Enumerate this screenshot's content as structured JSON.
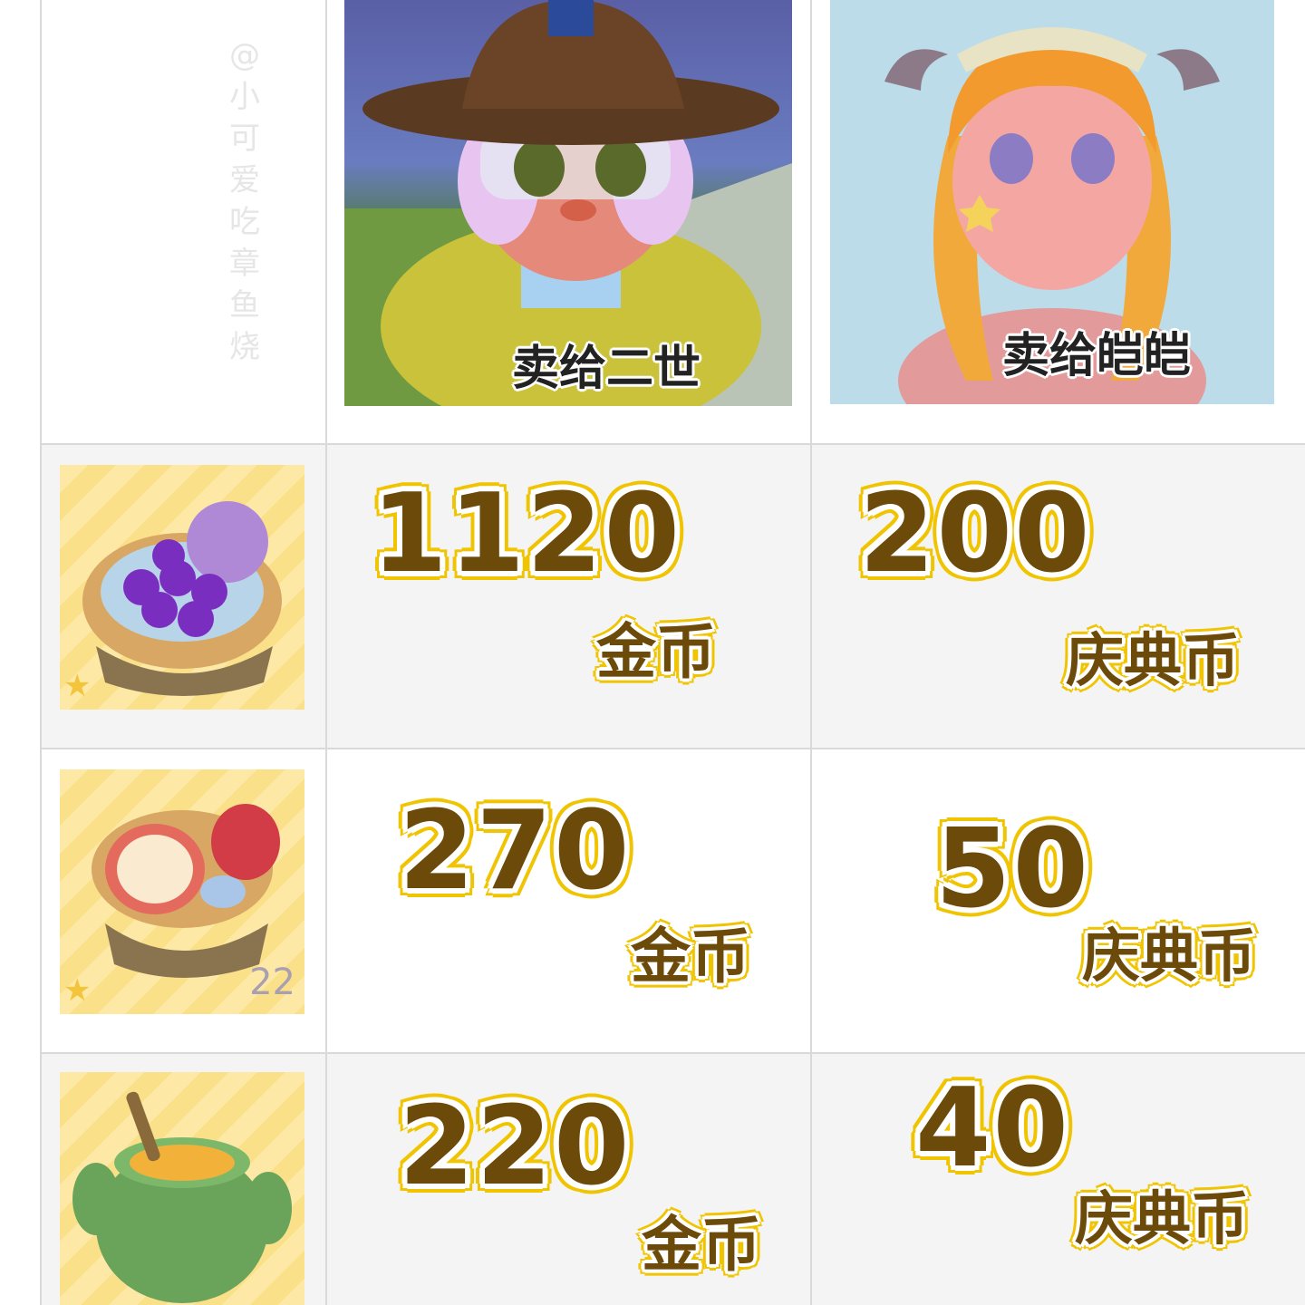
{
  "watermark": "@小可爱吃章鱼烧",
  "header": {
    "col1_caption": "卖给二世",
    "col2_caption": "卖给皑皑"
  },
  "rows": [
    {
      "count": "",
      "gold": "1120",
      "gold_unit": "金币",
      "festival": "200",
      "festival_unit": "庆典币"
    },
    {
      "count": "22",
      "gold": "270",
      "gold_unit": "金币",
      "festival": "50",
      "festival_unit": "庆典币"
    },
    {
      "count": "",
      "gold": "220",
      "gold_unit": "金币",
      "festival": "40",
      "festival_unit": "庆典币"
    }
  ],
  "colors": {
    "outline": "#f0c400",
    "number": "#6b4a0a",
    "grid": "#d9d9d9"
  }
}
